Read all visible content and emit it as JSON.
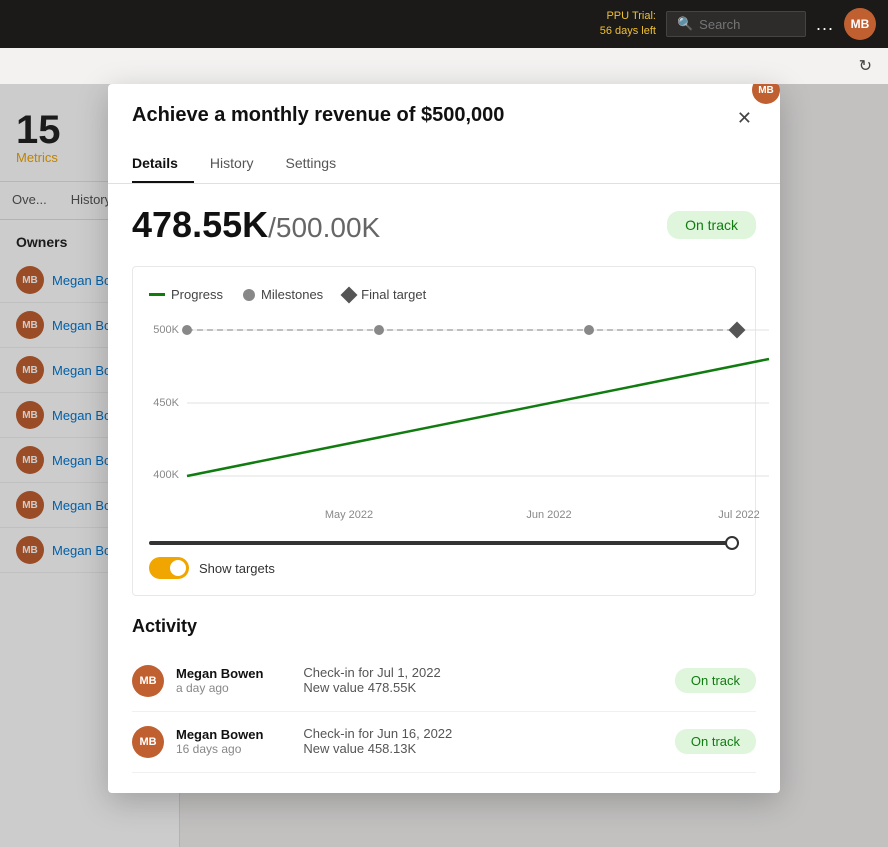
{
  "navbar": {
    "ppu_trial_label": "PPU Trial:",
    "ppu_trial_days": "56 days left",
    "search_placeholder": "Search",
    "dots_label": "...",
    "avatar_initials": "MB"
  },
  "reload": {
    "icon": "↻"
  },
  "sidebar": {
    "metrics_count": "15",
    "metrics_label": "Metrics",
    "tabs": [
      {
        "label": "Ove...",
        "active": false
      },
      {
        "label": "History",
        "active": false
      }
    ],
    "owners_header": "Owners",
    "owners": [
      {
        "name": "Megan Bower",
        "initials": "MB"
      },
      {
        "name": "Megan Bower",
        "initials": "MB"
      },
      {
        "name": "Megan Bower",
        "initials": "MB"
      },
      {
        "name": "Megan Bower",
        "initials": "MB"
      },
      {
        "name": "Megan Bower",
        "initials": "MB"
      },
      {
        "name": "Megan Bower",
        "initials": "MB"
      },
      {
        "name": "Megan Bower",
        "initials": "MB"
      }
    ]
  },
  "modal": {
    "title": "Achieve a monthly revenue of $500,000",
    "close_icon": "✕",
    "tabs": [
      {
        "label": "Details",
        "active": true
      },
      {
        "label": "History",
        "active": false
      },
      {
        "label": "Settings",
        "active": false
      }
    ],
    "current_value": "478.55K",
    "target_value": "/500.00K",
    "on_track_label": "On track",
    "legend": {
      "progress": "Progress",
      "milestones": "Milestones",
      "final_target": "Final target"
    },
    "chart": {
      "y_labels": [
        "500K",
        "450K",
        "400K"
      ],
      "x_labels": [
        "May 2022",
        "Jun 2022",
        "Jul 2022"
      ]
    },
    "show_targets_label": "Show targets",
    "activity_header": "Activity",
    "activity_items": [
      {
        "name": "Megan Bowen",
        "initials": "MB",
        "time": "a day ago",
        "checkin": "Check-in for Jul 1, 2022",
        "new_value": "New value 478.55K",
        "badge": "On track"
      },
      {
        "name": "Megan Bowen",
        "initials": "MB",
        "time": "16 days ago",
        "checkin": "Check-in for Jun 16, 2022",
        "new_value": "New value 458.13K",
        "badge": "On track"
      }
    ]
  },
  "colors": {
    "accent_blue": "#0078d4",
    "on_track_green": "#107c10",
    "on_track_bg": "#dff6dd",
    "metrics_yellow": "#f0a500",
    "avatar_brown": "#c06030",
    "progress_line": "#107c10"
  }
}
